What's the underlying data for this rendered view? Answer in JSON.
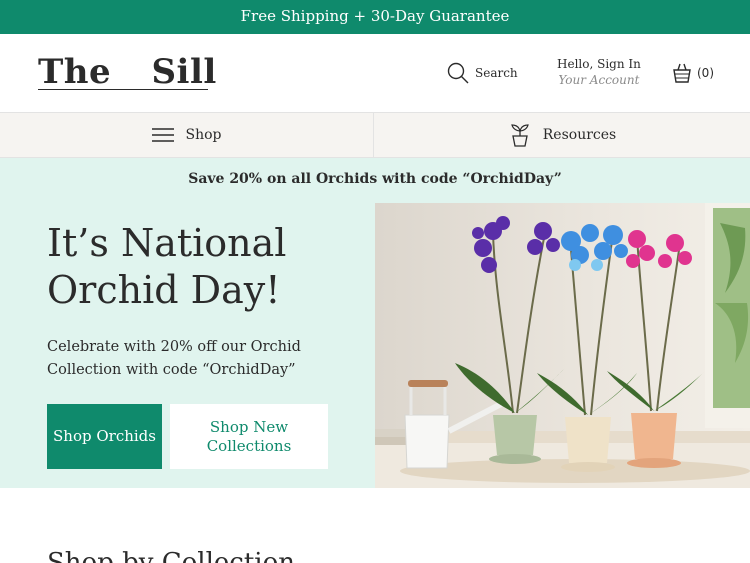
{
  "announcement": {
    "text": "Free Shipping + 30-Day Guarantee"
  },
  "header": {
    "logo": "The Sill",
    "search_label": "Search",
    "account_line1": "Hello, Sign In",
    "account_line2": "Your Account",
    "cart_count": "(0)"
  },
  "subnav": {
    "shop_label": "Shop",
    "resources_label": "Resources"
  },
  "promo": {
    "banner": "Save 20% on all Orchids with code “OrchidDay”",
    "title": "It’s National Orchid Day!",
    "description": "Celebrate with 20% off our Orchid Collection with code “OrchidDay”",
    "primary_button": "Shop Orchids",
    "secondary_button": "Shop New Collections"
  },
  "below": {
    "section_title": "Shop by Collection"
  },
  "colors": {
    "brand_green": "#0f8a6c",
    "promo_bg": "#e0f4ee",
    "subnav_bg": "#f6f4f1",
    "text": "#2b2b2b"
  },
  "icons": [
    "search-icon",
    "cart-icon",
    "menu-icon",
    "plant-icon"
  ]
}
